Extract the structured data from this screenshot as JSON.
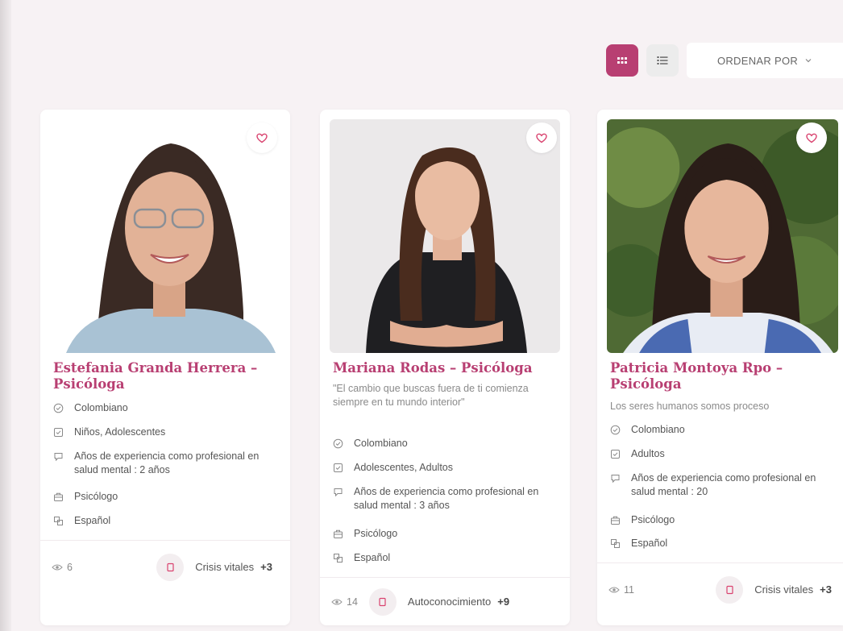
{
  "toolbar": {
    "sort_label": "ORDENAR POR",
    "grid_icon": "grid-icon",
    "list_icon": "list-icon"
  },
  "colors": {
    "accent": "#b83f72",
    "background": "#f7f2f4"
  },
  "cards": [
    {
      "name": "Estefania Granda Herrera – Psicóloga",
      "quote": "",
      "nationality": "Colombiano",
      "audience": "Niños, Adolescentes",
      "experience": "Años de experiencia como profesional en salud mental : 2 años",
      "profession": "Psicólogo",
      "language": "Español",
      "views": "6",
      "tag": "Crisis vitales",
      "tag_more": "+3"
    },
    {
      "name": "Mariana Rodas – Psicóloga",
      "quote": "\"El cambio que buscas fuera de ti comienza siempre en tu mundo interior\"",
      "nationality": "Colombiano",
      "audience": "Adolescentes, Adultos",
      "experience": "Años de experiencia como profesional en salud mental : 3 años",
      "profession": "Psicólogo",
      "language": "Español",
      "views": "14",
      "tag": "Autoconocimiento",
      "tag_more": "+9"
    },
    {
      "name": "Patricia Montoya Rpo – Psicóloga",
      "quote": "Los seres humanos somos proceso",
      "nationality": "Colombiano",
      "audience": "Adultos",
      "experience": "Años de experiencia como profesional en salud mental : 20",
      "profession": "Psicólogo",
      "language": "Español",
      "views": "11",
      "tag": "Crisis vitales",
      "tag_more": "+3"
    }
  ]
}
